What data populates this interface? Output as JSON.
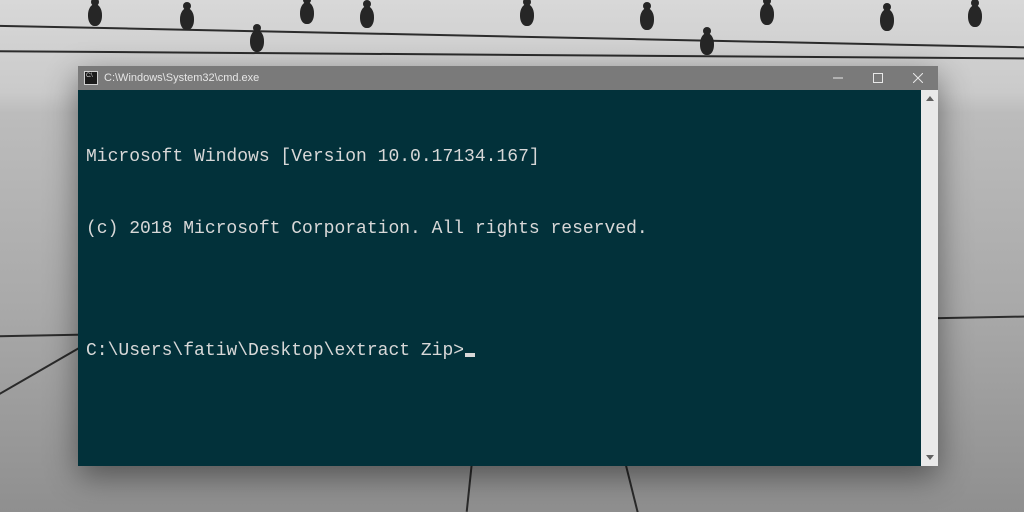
{
  "window": {
    "title": "C:\\Windows\\System32\\cmd.exe"
  },
  "terminal": {
    "version_line": "Microsoft Windows [Version 10.0.17134.167]",
    "copyright_line": "(c) 2018 Microsoft Corporation. All rights reserved.",
    "blank": "",
    "prompt": "C:\\Users\\fatiw\\Desktop\\extract Zip>"
  }
}
